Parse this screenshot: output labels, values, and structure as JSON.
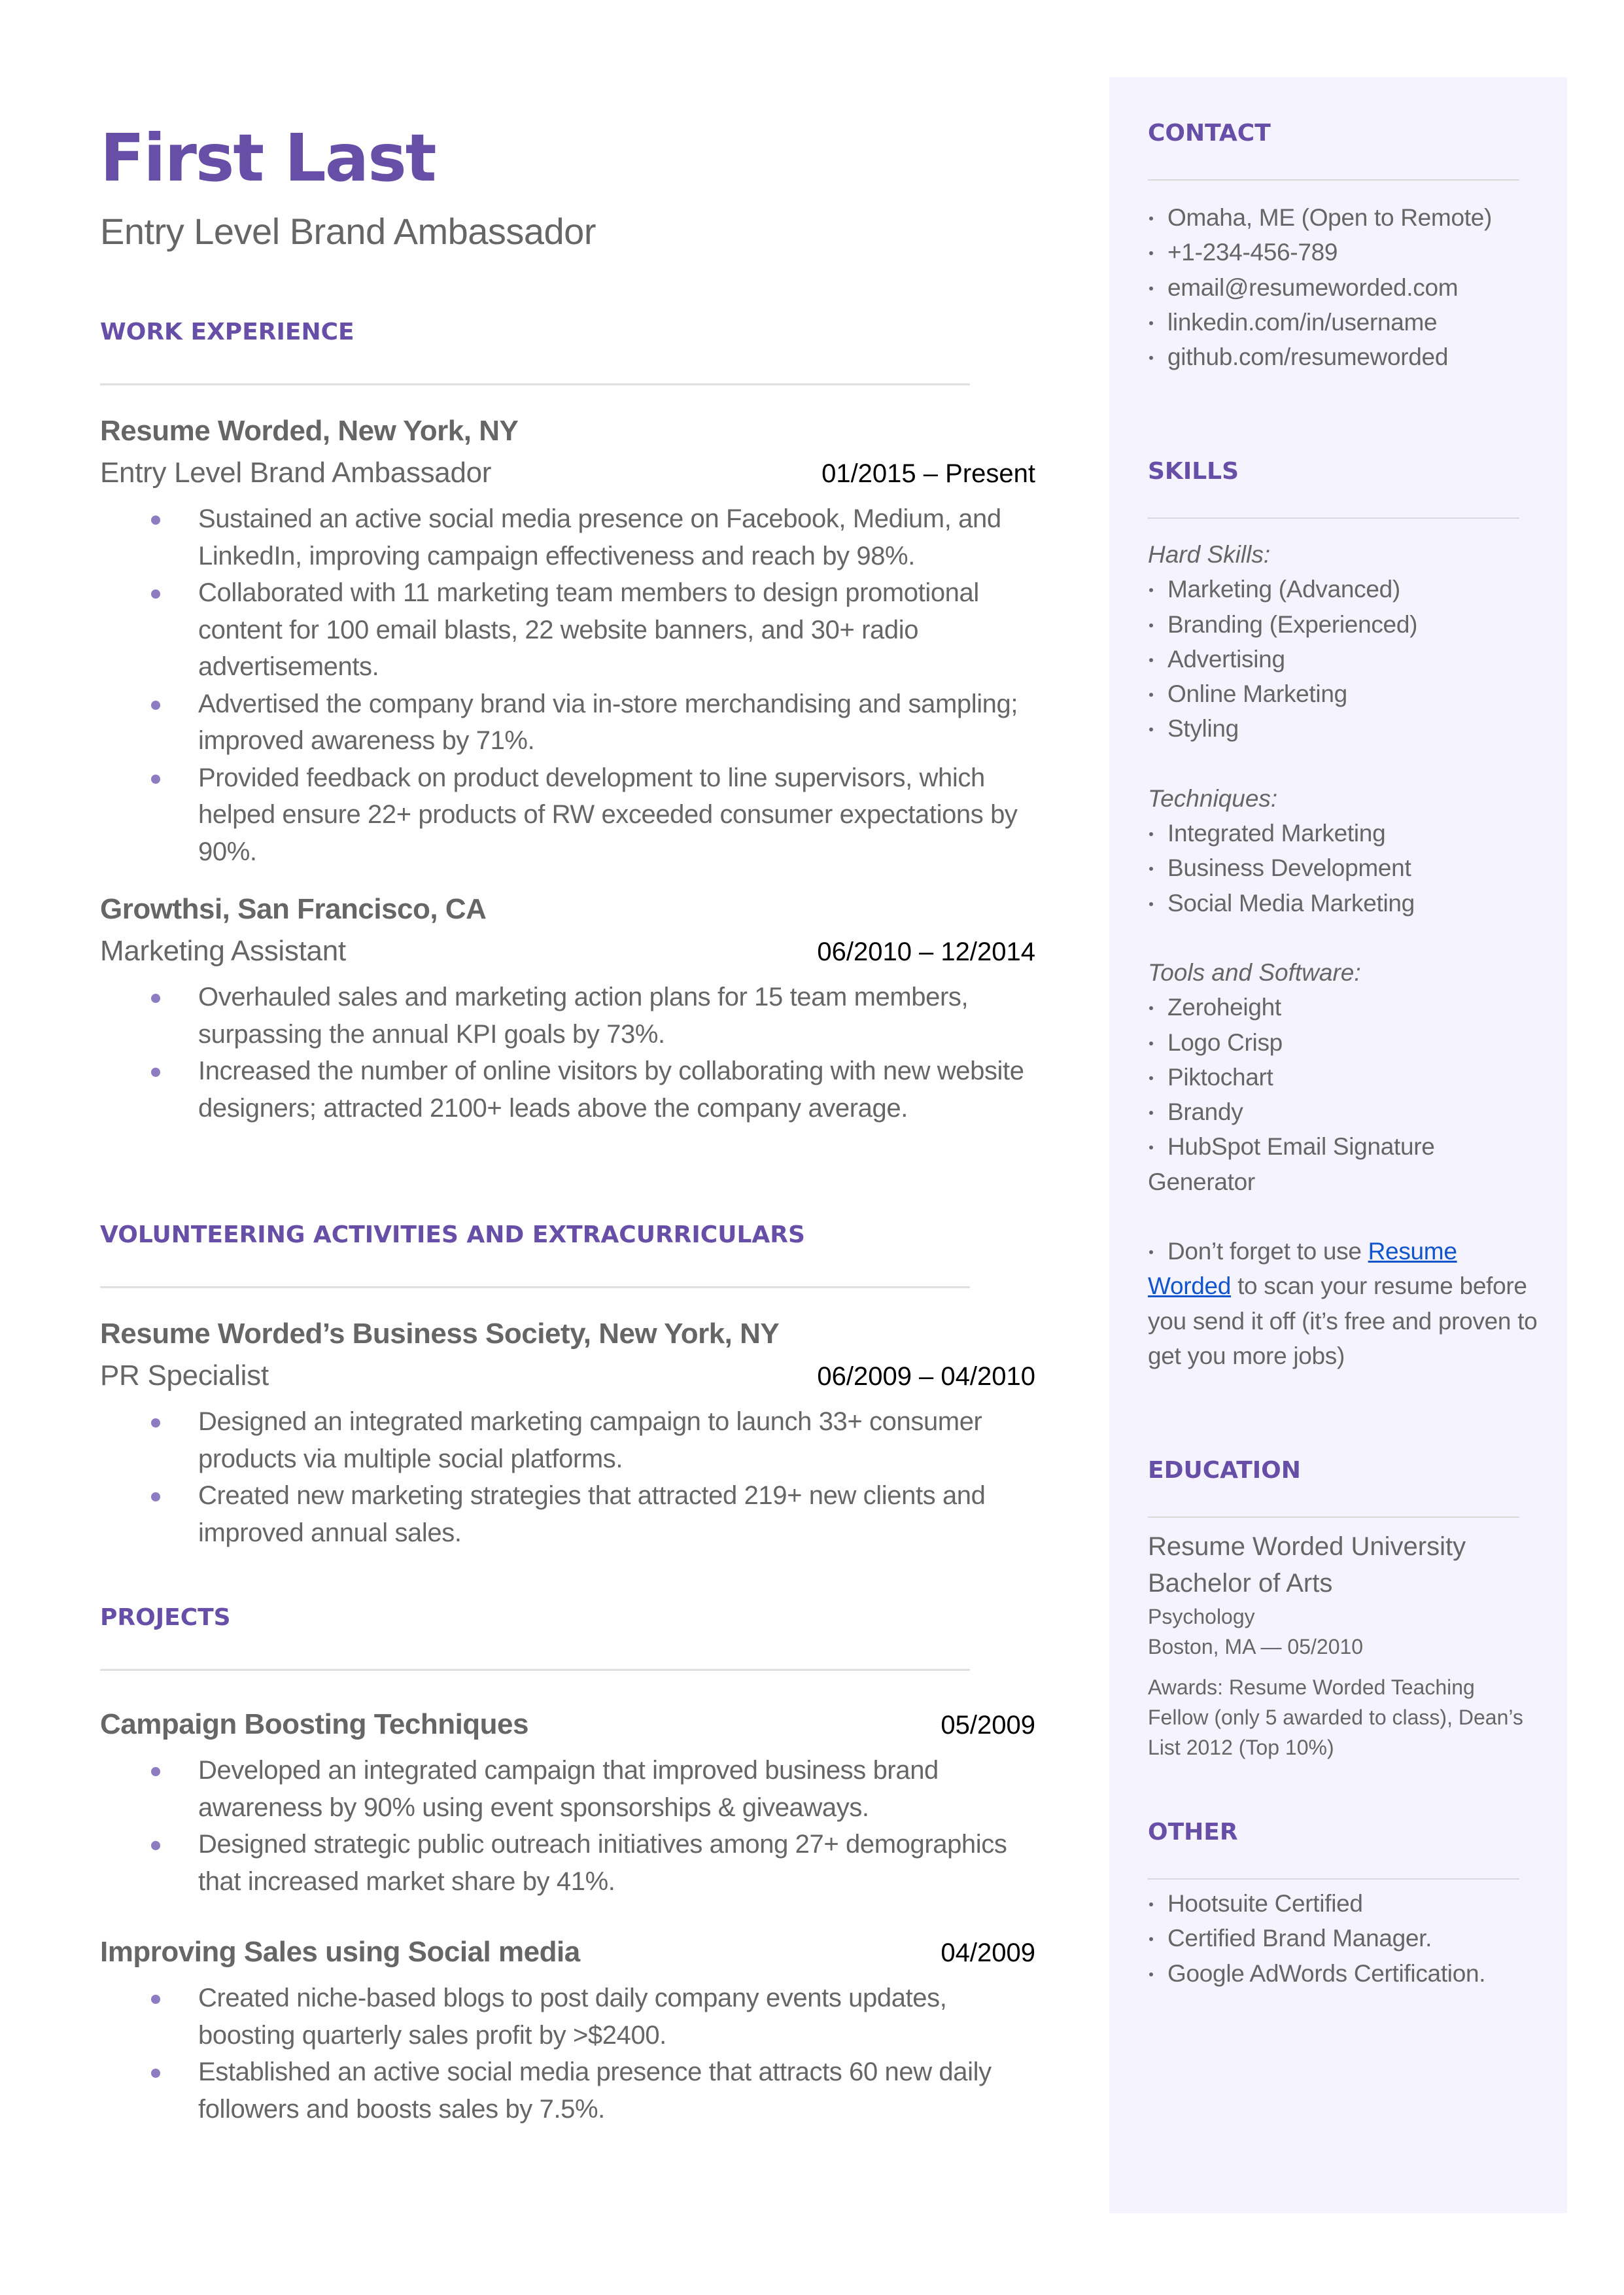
{
  "header": {
    "name": "First Last",
    "title": "Entry Level Brand Ambassador"
  },
  "theme": {
    "accent": "#674ea7",
    "bullet": "#8e7cc3",
    "sidebar_bg": "#f5f3fe",
    "text": "#666666",
    "link": "#1155cc"
  },
  "work_experience": {
    "heading": "WORK EXPERIENCE",
    "entries": [
      {
        "org": "Resume Worded, New York, NY",
        "role": "Entry Level Brand Ambassador",
        "date": "01/2015 – Present",
        "bullets": [
          "Sustained an active social media presence on Facebook, Medium, and LinkedIn, improving campaign effectiveness and reach by 98%.",
          "Collaborated with 11 marketing team members to design promotional content for 100 email blasts, 22 website banners, and 30+ radio advertisements.",
          "Advertised the company brand via in-store merchandising and sampling; improved awareness by 71%.",
          "Provided feedback on product development to line supervisors, which helped ensure 22+ products of RW exceeded consumer expectations by 90%."
        ]
      },
      {
        "org": "Growthsi, San Francisco, CA",
        "role": "Marketing Assistant",
        "date": "06/2010 – 12/2014",
        "bullets": [
          "Overhauled sales and marketing action plans for 15 team members, surpassing the annual KPI goals by 73%.",
          "Increased the number of online visitors by collaborating with new website designers; attracted 2100+ leads above the company average."
        ]
      }
    ]
  },
  "volunteering": {
    "heading": "VOLUNTEERING ACTIVITIES AND EXTRACURRICULARS",
    "entries": [
      {
        "org": "Resume Worded’s Business Society, New York, NY",
        "role": "PR Specialist",
        "date": "06/2009 – 04/2010",
        "bullets": [
          "Designed an integrated marketing campaign to launch 33+ consumer products via multiple social platforms.",
          "Created new marketing strategies that attracted 219+ new clients and improved annual sales."
        ]
      }
    ]
  },
  "projects": {
    "heading": "PROJECTS",
    "entries": [
      {
        "title": "Campaign Boosting Techniques",
        "date": "05/2009",
        "bullets": [
          "Developed an integrated campaign that improved business brand awareness by 90% using event sponsorships & giveaways.",
          "Designed strategic public outreach initiatives among 27+ demographics that increased market share by 41%."
        ]
      },
      {
        "title": "Improving Sales using Social media",
        "date": "04/2009",
        "bullets": [
          "Created niche-based blogs to post daily company events updates, boosting quarterly sales profit by >$2400.",
          "Established an active social media presence that attracts 60 new daily followers and boosts sales by 7.5%."
        ]
      }
    ]
  },
  "sidebar": {
    "contact": {
      "heading": "CONTACT",
      "items": [
        " Omaha, ME (Open to Remote)",
        "+1-234-456-789",
        "email@resumeworded.com",
        "linkedin.com/in/username",
        "github.com/resumeworded"
      ]
    },
    "skills": {
      "heading": "SKILLS",
      "hard_label": "Hard Skills:",
      "hard": [
        "Marketing (Advanced)",
        "Branding (Experienced)",
        "Advertising",
        "Online Marketing",
        "Styling"
      ],
      "tech_label": "Techniques:",
      "techniques": [
        "Integrated Marketing",
        "Business Development",
        "Social Media Marketing"
      ],
      "tools_label": "Tools and Software:",
      "tools": [
        "Zeroheight",
        "Logo Crisp",
        "Piktochart",
        "Brandy",
        "HubSpot Email Signature"
      ],
      "tools_continuation": "Generator",
      "tip_prefix": "Don’t forget to use ",
      "tip_link": "Resume Worded",
      "tip_suffix": " to scan your resume before you send it off (it’s free and proven to get you more jobs)"
    },
    "education": {
      "heading": "EDUCATION",
      "school": "Resume Worded University",
      "degree": "Bachelor of Arts",
      "major": "Psychology",
      "location_date": "Boston, MA — 05/2010",
      "awards": "Awards: Resume Worded Teaching Fellow (only 5 awarded to class), Dean’s List 2012 (Top 10%)"
    },
    "other": {
      "heading": "OTHER",
      "items": [
        "Hootsuite Certified",
        "Certified Brand Manager.",
        "Google AdWords Certification."
      ]
    }
  }
}
